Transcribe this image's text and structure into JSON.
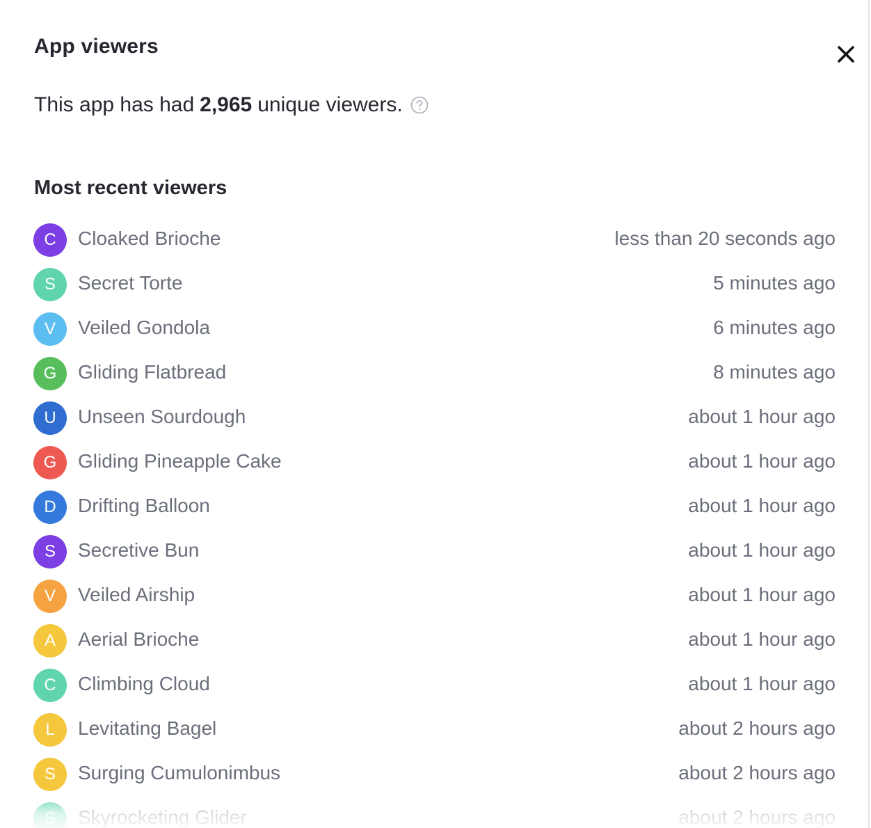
{
  "dialog": {
    "title": "App viewers",
    "close_icon": "close-icon",
    "summary": {
      "prefix": "This app has had",
      "count": "2,965",
      "suffix": "unique viewers.",
      "help_icon": "question-circle-icon"
    },
    "section_heading": "Most recent viewers"
  },
  "viewers": [
    {
      "initial": "C",
      "name": "Cloaked Brioche",
      "time": "less than 20 seconds ago",
      "color": "#7b3fe4"
    },
    {
      "initial": "S",
      "name": "Secret Torte",
      "time": "5 minutes ago",
      "color": "#5fd4ad"
    },
    {
      "initial": "V",
      "name": "Veiled Gondola",
      "time": "6 minutes ago",
      "color": "#5bbdf0"
    },
    {
      "initial": "G",
      "name": "Gliding Flatbread",
      "time": "8 minutes ago",
      "color": "#58be5c"
    },
    {
      "initial": "U",
      "name": "Unseen Sourdough",
      "time": "about 1 hour ago",
      "color": "#2f6dd0"
    },
    {
      "initial": "G",
      "name": "Gliding Pineapple Cake",
      "time": "about 1 hour ago",
      "color": "#ee5a52"
    },
    {
      "initial": "D",
      "name": "Drifting Balloon",
      "time": "about 1 hour ago",
      "color": "#3479db"
    },
    {
      "initial": "S",
      "name": "Secretive Bun",
      "time": "about 1 hour ago",
      "color": "#7b3fe4"
    },
    {
      "initial": "V",
      "name": "Veiled Airship",
      "time": "about 1 hour ago",
      "color": "#f5a340"
    },
    {
      "initial": "A",
      "name": "Aerial Brioche",
      "time": "about 1 hour ago",
      "color": "#f5c73c"
    },
    {
      "initial": "C",
      "name": "Climbing Cloud",
      "time": "about 1 hour ago",
      "color": "#5fd4ad"
    },
    {
      "initial": "L",
      "name": "Levitating Bagel",
      "time": "about 2 hours ago",
      "color": "#f5c73c"
    },
    {
      "initial": "S",
      "name": "Surging Cumulonimbus",
      "time": "about 2 hours ago",
      "color": "#f5c73c"
    },
    {
      "initial": "S",
      "name": "Skyrocketing Glider",
      "time": "about 2 hours ago",
      "color": "#5fd4ad"
    }
  ]
}
